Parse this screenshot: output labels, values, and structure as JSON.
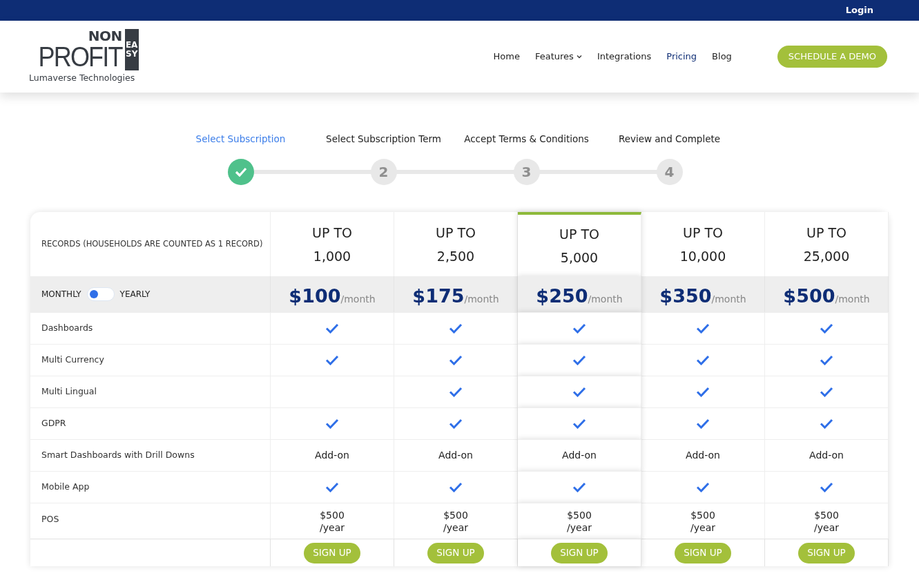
{
  "top_bar": {
    "login": "Login"
  },
  "header": {
    "logo": {
      "top": "NON",
      "main": "PROFIT",
      "side": "EASY",
      "subtitle": "Lumaverse Technologies"
    },
    "nav": [
      {
        "label": "Home",
        "selected": false,
        "dropdown": false
      },
      {
        "label": "Features",
        "selected": false,
        "dropdown": true
      },
      {
        "label": "Integrations",
        "selected": false,
        "dropdown": false
      },
      {
        "label": "Pricing",
        "selected": true,
        "dropdown": false
      },
      {
        "label": "Blog",
        "selected": false,
        "dropdown": false
      }
    ],
    "cta": "SCHEDULE A DEMO"
  },
  "steps": [
    {
      "label": "Select Subscription",
      "completed": true
    },
    {
      "label": "Select Subscription Term",
      "number": "2",
      "completed": false
    },
    {
      "label": "Accept Terms & Conditions",
      "number": "3",
      "completed": false
    },
    {
      "label": "Review and Complete",
      "number": "4",
      "completed": false
    }
  ],
  "pricing": {
    "records_label": "RECORDS (HOUSEHOLDS ARE COUNTED AS 1 RECORD)",
    "billing": {
      "monthly": "MONTHLY",
      "yearly_label": "YEARLY",
      "yearly": false
    },
    "plans": [
      {
        "up_to": "UP TO",
        "records": "1,000",
        "price": "$100",
        "period": "/month",
        "featured": false,
        "button": "SIGN UP"
      },
      {
        "up_to": "UP TO",
        "records": "2,500",
        "price": "$175",
        "period": "/month",
        "featured": false,
        "button": "SIGN UP"
      },
      {
        "up_to": "UP TO",
        "records": "5,000",
        "price": "$250",
        "period": "/month",
        "featured": true,
        "button": "SIGN UP"
      },
      {
        "up_to": "UP TO",
        "records": "10,000",
        "price": "$350",
        "period": "/month",
        "featured": false,
        "button": "SIGN UP"
      },
      {
        "up_to": "UP TO",
        "records": "25,000",
        "price": "$500",
        "period": "/month",
        "featured": false,
        "button": "SIGN UP"
      }
    ],
    "features": [
      {
        "name": "Dashboards",
        "cells": [
          {
            "kind": "check"
          },
          {
            "kind": "check"
          },
          {
            "kind": "check"
          },
          {
            "kind": "check"
          },
          {
            "kind": "check"
          }
        ]
      },
      {
        "name": "Multi Currency",
        "cells": [
          {
            "kind": "check"
          },
          {
            "kind": "check"
          },
          {
            "kind": "check"
          },
          {
            "kind": "check"
          },
          {
            "kind": "check"
          }
        ]
      },
      {
        "name": "Multi Lingual",
        "cells": [
          {
            "kind": "blank"
          },
          {
            "kind": "check"
          },
          {
            "kind": "check"
          },
          {
            "kind": "check"
          },
          {
            "kind": "check"
          }
        ]
      },
      {
        "name": "GDPR",
        "cells": [
          {
            "kind": "check"
          },
          {
            "kind": "check"
          },
          {
            "kind": "check"
          },
          {
            "kind": "check"
          },
          {
            "kind": "check"
          }
        ]
      },
      {
        "name": "Smart Dashboards with Drill Downs",
        "cells": [
          {
            "kind": "text",
            "text": "Add-on"
          },
          {
            "kind": "text",
            "text": "Add-on"
          },
          {
            "kind": "text",
            "text": "Add-on"
          },
          {
            "kind": "text",
            "text": "Add-on"
          },
          {
            "kind": "text",
            "text": "Add-on"
          }
        ]
      },
      {
        "name": "Mobile App",
        "cells": [
          {
            "kind": "check"
          },
          {
            "kind": "check"
          },
          {
            "kind": "check"
          },
          {
            "kind": "check"
          },
          {
            "kind": "check"
          }
        ]
      },
      {
        "name": "POS",
        "cells": [
          {
            "kind": "price",
            "price": "$500",
            "period": "/year"
          },
          {
            "kind": "price",
            "price": "$500",
            "period": "/year"
          },
          {
            "kind": "price",
            "price": "$500",
            "period": "/year"
          },
          {
            "kind": "price",
            "price": "$500",
            "period": "/year"
          },
          {
            "kind": "price",
            "price": "$500",
            "period": "/year"
          }
        ]
      }
    ]
  }
}
